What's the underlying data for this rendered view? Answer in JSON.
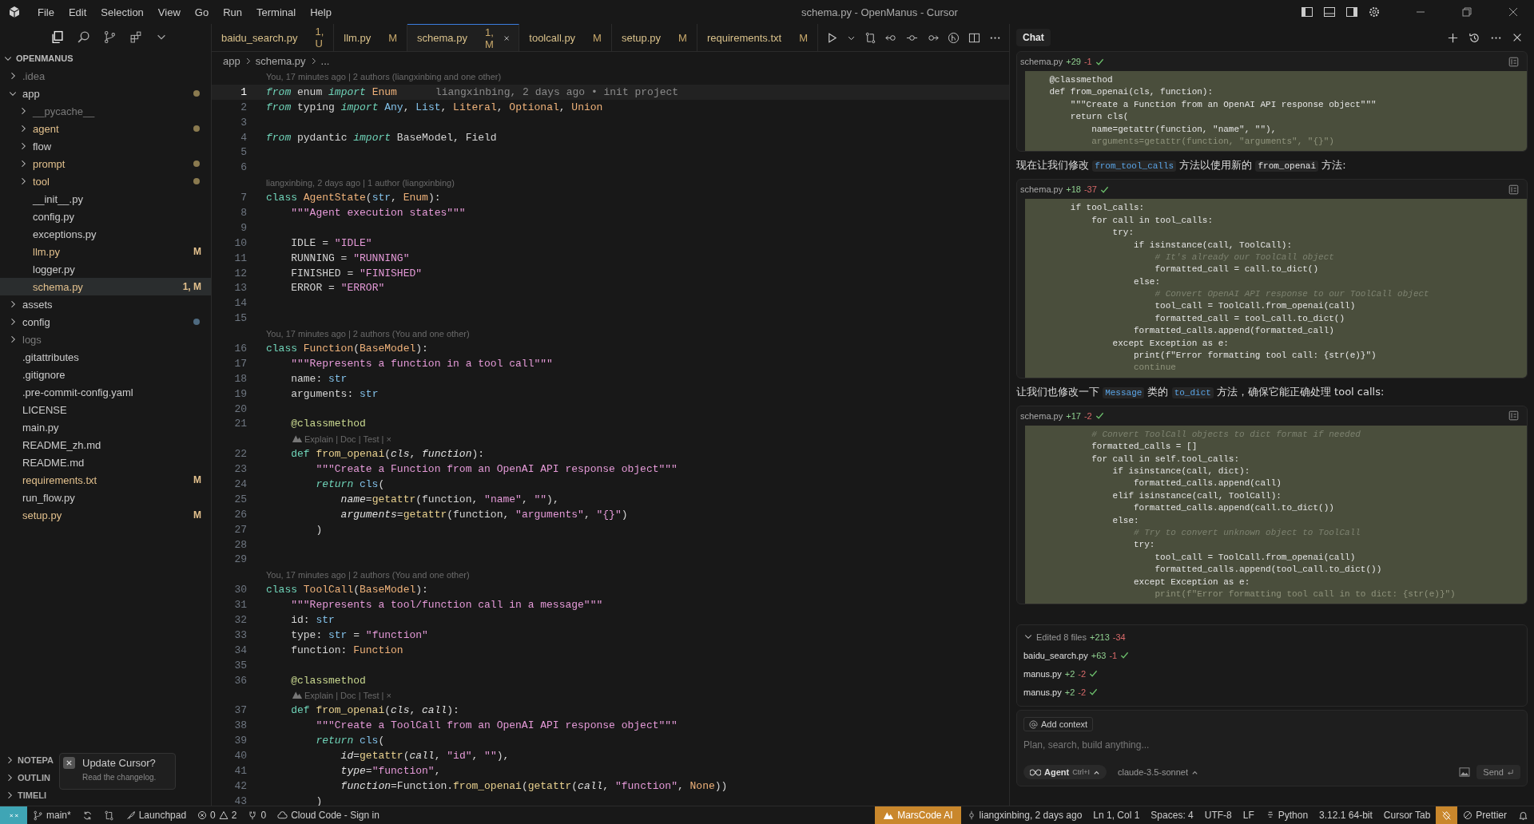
{
  "title_bar": {
    "menu": [
      "File",
      "Edit",
      "Selection",
      "View",
      "Go",
      "Run",
      "Terminal",
      "Help"
    ],
    "title": "schema.py - OpenManus - Cursor"
  },
  "explorer": {
    "title": "OPENMANUS",
    "items": [
      {
        "name": ".idea",
        "kind": "folder",
        "expanded": false,
        "modified": false,
        "ignored": true,
        "selected": false
      },
      {
        "name": "app",
        "kind": "folder",
        "expanded": true,
        "modified": false,
        "ignored": false,
        "color": "#8a7a4f",
        "selected": false,
        "children": [
          {
            "name": "__pycache__",
            "kind": "folder",
            "expanded": false,
            "modified": false,
            "ignored": true,
            "selected": false
          },
          {
            "name": "agent",
            "kind": "folder",
            "expanded": false,
            "modified": true,
            "ignored": false,
            "color": "#8a7a4f",
            "selected": false
          },
          {
            "name": "flow",
            "kind": "folder",
            "expanded": false,
            "modified": false,
            "ignored": false,
            "selected": false
          },
          {
            "name": "prompt",
            "kind": "folder",
            "expanded": false,
            "modified": true,
            "ignored": false,
            "color": "#8a7a4f",
            "selected": false
          },
          {
            "name": "tool",
            "kind": "folder",
            "expanded": false,
            "modified": true,
            "ignored": false,
            "color": "#8a7a4f",
            "selected": false
          },
          {
            "name": "__init__.py",
            "kind": "file",
            "modified": false,
            "ignored": false,
            "selected": false
          },
          {
            "name": "config.py",
            "kind": "file",
            "modified": false,
            "ignored": false,
            "selected": false
          },
          {
            "name": "exceptions.py",
            "kind": "file",
            "modified": false,
            "ignored": false,
            "selected": false
          },
          {
            "name": "llm.py",
            "kind": "file",
            "modified": true,
            "ignored": false,
            "badge": "M",
            "selected": false
          },
          {
            "name": "logger.py",
            "kind": "file",
            "modified": false,
            "ignored": false,
            "selected": false
          },
          {
            "name": "schema.py",
            "kind": "file",
            "modified": true,
            "ignored": false,
            "badge": "1, M",
            "selected": true
          }
        ]
      },
      {
        "name": "assets",
        "kind": "folder",
        "expanded": false,
        "modified": false,
        "ignored": false,
        "selected": false
      },
      {
        "name": "config",
        "kind": "folder",
        "expanded": false,
        "modified": false,
        "ignored": false,
        "color": "#4e6a80",
        "selected": false
      },
      {
        "name": "logs",
        "kind": "folder",
        "expanded": false,
        "modified": false,
        "ignored": true,
        "selected": false
      },
      {
        "name": ".gitattributes",
        "kind": "file",
        "modified": false,
        "ignored": false,
        "selected": false
      },
      {
        "name": ".gitignore",
        "kind": "file",
        "modified": false,
        "ignored": false,
        "selected": false
      },
      {
        "name": ".pre-commit-config.yaml",
        "kind": "file",
        "modified": false,
        "ignored": false,
        "selected": false
      },
      {
        "name": "LICENSE",
        "kind": "file",
        "modified": false,
        "ignored": false,
        "selected": false
      },
      {
        "name": "main.py",
        "kind": "file",
        "modified": false,
        "ignored": false,
        "selected": false
      },
      {
        "name": "README_zh.md",
        "kind": "file",
        "modified": false,
        "ignored": false,
        "selected": false
      },
      {
        "name": "README.md",
        "kind": "file",
        "modified": false,
        "ignored": false,
        "selected": false
      },
      {
        "name": "requirements.txt",
        "kind": "file",
        "modified": true,
        "ignored": false,
        "badge": "M",
        "selected": false
      },
      {
        "name": "run_flow.py",
        "kind": "file",
        "modified": false,
        "ignored": false,
        "selected": false
      },
      {
        "name": "setup.py",
        "kind": "file",
        "modified": true,
        "ignored": false,
        "badge": "M",
        "selected": false
      }
    ],
    "sections": [
      "NOTEPA",
      "OUTLIN",
      "TIMELI"
    ]
  },
  "notification": {
    "title": "Update Cursor?",
    "message": "Read the changelog."
  },
  "tabs": [
    {
      "label": "baidu_search.py",
      "badge": "1, U",
      "selected": false
    },
    {
      "label": "llm.py",
      "badge": "M",
      "selected": false
    },
    {
      "label": "schema.py",
      "badge": "1, M",
      "selected": true
    },
    {
      "label": "toolcall.py",
      "badge": "M",
      "selected": false
    },
    {
      "label": "setup.py",
      "badge": "M",
      "selected": false
    },
    {
      "label": "requirements.txt",
      "badge": "M",
      "selected": false
    }
  ],
  "breadcrumb": [
    "app",
    "schema.py",
    "..."
  ],
  "editor": {
    "rows": [
      {
        "kind": "annotation",
        "text": "You, 17 minutes ago | 2 authors (liangxinbing and one other)"
      },
      {
        "kind": "code",
        "number": "1",
        "active": true,
        "blame": "liangxinbing, 2 days ago • init project",
        "segments": [
          {
            "kind": "kw",
            "text": "from"
          },
          {
            "kind": "plain",
            "text": " enum "
          },
          {
            "kind": "kw",
            "text": "import"
          },
          {
            "kind": "cls",
            "text": " Enum"
          }
        ]
      },
      {
        "kind": "code",
        "number": "2",
        "active": false,
        "segments": [
          {
            "kind": "kw",
            "text": "from"
          },
          {
            "kind": "plain",
            "text": " typing "
          },
          {
            "kind": "kw",
            "text": "import"
          },
          {
            "kind": "type",
            "text": " Any"
          },
          {
            "kind": "plain",
            "text": ", "
          },
          {
            "kind": "type",
            "text": "List"
          },
          {
            "kind": "plain",
            "text": ", "
          },
          {
            "kind": "cls",
            "text": "Literal"
          },
          {
            "kind": "plain",
            "text": ", "
          },
          {
            "kind": "cls",
            "text": "Optional"
          },
          {
            "kind": "plain",
            "text": ", "
          },
          {
            "kind": "cls",
            "text": "Union"
          }
        ]
      },
      {
        "kind": "code",
        "number": "3",
        "active": false
      },
      {
        "kind": "code",
        "number": "4",
        "active": false,
        "segments": [
          {
            "kind": "kw",
            "text": "from"
          },
          {
            "kind": "plain",
            "text": " pydantic "
          },
          {
            "kind": "kw",
            "text": "import"
          },
          {
            "kind": "plain",
            "text": " BaseModel, Field"
          }
        ]
      },
      {
        "kind": "code",
        "number": "5",
        "active": false
      },
      {
        "kind": "code",
        "number": "6",
        "active": false
      },
      {
        "kind": "annotation",
        "text": "liangxinbing, 2 days ago | 1 author (liangxinbing)"
      },
      {
        "kind": "code",
        "number": "7",
        "active": false,
        "segments": [
          {
            "kind": "storage",
            "text": "class"
          },
          {
            "kind": "cls",
            "text": " AgentState"
          },
          {
            "kind": "plain",
            "text": "("
          },
          {
            "kind": "type",
            "text": "str"
          },
          {
            "kind": "plain",
            "text": ", "
          },
          {
            "kind": "cls",
            "text": "Enum"
          },
          {
            "kind": "plain",
            "text": "):"
          }
        ]
      },
      {
        "kind": "code",
        "number": "8",
        "active": false,
        "segments": [
          {
            "kind": "str",
            "text": "    \"\"\"Agent execution states\"\"\""
          }
        ]
      },
      {
        "kind": "code",
        "number": "9",
        "active": false
      },
      {
        "kind": "code",
        "number": "10",
        "active": false,
        "segments": [
          {
            "kind": "plain",
            "text": "    IDLE = "
          },
          {
            "kind": "str",
            "text": "\"IDLE\""
          }
        ]
      },
      {
        "kind": "code",
        "number": "11",
        "active": false,
        "segments": [
          {
            "kind": "plain",
            "text": "    RUNNING = "
          },
          {
            "kind": "str",
            "text": "\"RUNNING\""
          }
        ]
      },
      {
        "kind": "code",
        "number": "12",
        "active": false,
        "segments": [
          {
            "kind": "plain",
            "text": "    FINISHED = "
          },
          {
            "kind": "str",
            "text": "\"FINISHED\""
          }
        ]
      },
      {
        "kind": "code",
        "number": "13",
        "active": false,
        "segments": [
          {
            "kind": "plain",
            "text": "    ERROR = "
          },
          {
            "kind": "str",
            "text": "\"ERROR\""
          }
        ]
      },
      {
        "kind": "code",
        "number": "14",
        "active": false
      },
      {
        "kind": "code",
        "number": "15",
        "active": false
      },
      {
        "kind": "annotation",
        "text": "You, 17 minutes ago | 2 authors (You and one other)"
      },
      {
        "kind": "code",
        "number": "16",
        "active": false,
        "segments": [
          {
            "kind": "storage",
            "text": "class"
          },
          {
            "kind": "cls",
            "text": " Function"
          },
          {
            "kind": "plain",
            "text": "("
          },
          {
            "kind": "cls",
            "text": "BaseModel"
          },
          {
            "kind": "plain",
            "text": "):"
          }
        ]
      },
      {
        "kind": "code",
        "number": "17",
        "active": false,
        "segments": [
          {
            "kind": "str",
            "text": "    \"\"\"Represents a function in a tool call\"\"\""
          }
        ]
      },
      {
        "kind": "code",
        "number": "18",
        "active": false,
        "segments": [
          {
            "kind": "plain",
            "text": "    name: "
          },
          {
            "kind": "type",
            "text": "str"
          }
        ]
      },
      {
        "kind": "code",
        "number": "19",
        "active": false,
        "segments": [
          {
            "kind": "plain",
            "text": "    arguments: "
          },
          {
            "kind": "type",
            "text": "str"
          }
        ]
      },
      {
        "kind": "code",
        "number": "20",
        "active": false
      },
      {
        "kind": "code",
        "number": "21",
        "active": false,
        "segments": [
          {
            "kind": "dec",
            "text": "    @classmethod"
          }
        ]
      },
      {
        "kind": "codelens",
        "text": "Explain | Doc | Test | ×"
      },
      {
        "kind": "code",
        "number": "22",
        "active": false,
        "segments": [
          {
            "kind": "storage",
            "text": "    def"
          },
          {
            "kind": "fn",
            "text": " from_openai"
          },
          {
            "kind": "plain",
            "text": "("
          },
          {
            "kind": "param",
            "text": "cls"
          },
          {
            "kind": "plain",
            "text": ", "
          },
          {
            "kind": "param",
            "text": "function"
          },
          {
            "kind": "plain",
            "text": "):"
          }
        ]
      },
      {
        "kind": "code",
        "number": "23",
        "active": false,
        "segments": [
          {
            "kind": "str",
            "text": "        \"\"\"Create a Function from an OpenAI API response object\"\"\""
          }
        ]
      },
      {
        "kind": "code",
        "number": "24",
        "active": false,
        "segments": [
          {
            "kind": "kw",
            "text": "        return"
          },
          {
            "kind": "type",
            "text": " cls"
          },
          {
            "kind": "plain",
            "text": "("
          }
        ]
      },
      {
        "kind": "code",
        "number": "25",
        "active": false,
        "segments": [
          {
            "kind": "param",
            "text": "            name"
          },
          {
            "kind": "plain",
            "text": "="
          },
          {
            "kind": "fn",
            "text": "getattr"
          },
          {
            "kind": "plain",
            "text": "(function, "
          },
          {
            "kind": "str",
            "text": "\"name\""
          },
          {
            "kind": "plain",
            "text": ", "
          },
          {
            "kind": "str",
            "text": "\"\""
          },
          {
            "kind": "plain",
            "text": "),"
          }
        ]
      },
      {
        "kind": "code",
        "number": "26",
        "active": false,
        "segments": [
          {
            "kind": "param",
            "text": "            arguments"
          },
          {
            "kind": "plain",
            "text": "="
          },
          {
            "kind": "fn",
            "text": "getattr"
          },
          {
            "kind": "plain",
            "text": "(function, "
          },
          {
            "kind": "str",
            "text": "\"arguments\""
          },
          {
            "kind": "plain",
            "text": ", "
          },
          {
            "kind": "str",
            "text": "\"{}\""
          },
          {
            "kind": "plain",
            "text": ")"
          }
        ]
      },
      {
        "kind": "code",
        "number": "27",
        "active": false,
        "segments": [
          {
            "kind": "plain",
            "text": "        )"
          }
        ]
      },
      {
        "kind": "code",
        "number": "28",
        "active": false
      },
      {
        "kind": "code",
        "number": "29",
        "active": false
      },
      {
        "kind": "annotation",
        "text": "You, 17 minutes ago | 2 authors (You and one other)"
      },
      {
        "kind": "code",
        "number": "30",
        "active": false,
        "segments": [
          {
            "kind": "storage",
            "text": "class"
          },
          {
            "kind": "cls",
            "text": " ToolCall"
          },
          {
            "kind": "plain",
            "text": "("
          },
          {
            "kind": "cls",
            "text": "BaseModel"
          },
          {
            "kind": "plain",
            "text": "):"
          }
        ]
      },
      {
        "kind": "code",
        "number": "31",
        "active": false,
        "segments": [
          {
            "kind": "str",
            "text": "    \"\"\"Represents a tool/function call in a message\"\"\""
          }
        ]
      },
      {
        "kind": "code",
        "number": "32",
        "active": false,
        "segments": [
          {
            "kind": "plain",
            "text": "    id: "
          },
          {
            "kind": "type",
            "text": "str"
          }
        ]
      },
      {
        "kind": "code",
        "number": "33",
        "active": false,
        "segments": [
          {
            "kind": "plain",
            "text": "    type: "
          },
          {
            "kind": "type",
            "text": "str"
          },
          {
            "kind": "plain",
            "text": " = "
          },
          {
            "kind": "str",
            "text": "\"function\""
          }
        ]
      },
      {
        "kind": "code",
        "number": "34",
        "active": false,
        "segments": [
          {
            "kind": "plain",
            "text": "    function: "
          },
          {
            "kind": "cls",
            "text": "Function"
          }
        ]
      },
      {
        "kind": "code",
        "number": "35",
        "active": false
      },
      {
        "kind": "code",
        "number": "36",
        "active": false,
        "segments": [
          {
            "kind": "dec",
            "text": "    @classmethod"
          }
        ]
      },
      {
        "kind": "codelens",
        "text": "Explain | Doc | Test | ×"
      },
      {
        "kind": "code",
        "number": "37",
        "active": false,
        "segments": [
          {
            "kind": "storage",
            "text": "    def"
          },
          {
            "kind": "fn",
            "text": " from_openai"
          },
          {
            "kind": "plain",
            "text": "("
          },
          {
            "kind": "param",
            "text": "cls"
          },
          {
            "kind": "plain",
            "text": ", "
          },
          {
            "kind": "param",
            "text": "call"
          },
          {
            "kind": "plain",
            "text": "):"
          }
        ]
      },
      {
        "kind": "code",
        "number": "38",
        "active": false,
        "segments": [
          {
            "kind": "str",
            "text": "        \"\"\"Create a ToolCall from an OpenAI API response object\"\"\""
          }
        ]
      },
      {
        "kind": "code",
        "number": "39",
        "active": false,
        "segments": [
          {
            "kind": "kw",
            "text": "        return"
          },
          {
            "kind": "type",
            "text": " cls"
          },
          {
            "kind": "plain",
            "text": "("
          }
        ]
      },
      {
        "kind": "code",
        "number": "40",
        "active": false,
        "segments": [
          {
            "kind": "param",
            "text": "            id"
          },
          {
            "kind": "plain",
            "text": "="
          },
          {
            "kind": "fn",
            "text": "getattr"
          },
          {
            "kind": "plain",
            "text": "("
          },
          {
            "kind": "param",
            "text": "call"
          },
          {
            "kind": "plain",
            "text": ", "
          },
          {
            "kind": "str",
            "text": "\"id\""
          },
          {
            "kind": "plain",
            "text": ", "
          },
          {
            "kind": "str",
            "text": "\"\""
          },
          {
            "kind": "plain",
            "text": "),"
          }
        ]
      },
      {
        "kind": "code",
        "number": "41",
        "active": false,
        "segments": [
          {
            "kind": "param",
            "text": "            type"
          },
          {
            "kind": "plain",
            "text": "="
          },
          {
            "kind": "str",
            "text": "\"function\""
          },
          {
            "kind": "plain",
            "text": ","
          }
        ]
      },
      {
        "kind": "code",
        "number": "42",
        "active": false,
        "segments": [
          {
            "kind": "param",
            "text": "            function"
          },
          {
            "kind": "plain",
            "text": "=Function."
          },
          {
            "kind": "fn",
            "text": "from_openai"
          },
          {
            "kind": "plain",
            "text": "("
          },
          {
            "kind": "fn",
            "text": "getattr"
          },
          {
            "kind": "plain",
            "text": "("
          },
          {
            "kind": "param",
            "text": "call"
          },
          {
            "kind": "plain",
            "text": ", "
          },
          {
            "kind": "str",
            "text": "\"function\""
          },
          {
            "kind": "plain",
            "text": ", "
          },
          {
            "kind": "cls",
            "text": "None"
          },
          {
            "kind": "plain",
            "text": "))"
          }
        ]
      },
      {
        "kind": "code",
        "number": "43",
        "active": false,
        "segments": [
          {
            "kind": "plain",
            "text": "        )"
          }
        ]
      }
    ]
  },
  "chat": {
    "tab": "Chat",
    "messages": [
      {
        "kind": "code_block",
        "file": "schema.py",
        "added": "+29",
        "removed": "-1",
        "lines": [
          {
            "kind": "code",
            "text": "    @classmethod"
          },
          {
            "kind": "code",
            "text": "    def from_openai(cls, function):"
          },
          {
            "kind": "code",
            "text": "        \"\"\"Create a Function from an OpenAI API response object\"\"\""
          },
          {
            "kind": "code",
            "text": "        return cls("
          },
          {
            "kind": "code",
            "text": "            name=getattr(function, \"name\", \"\"),"
          },
          {
            "kind": "cut",
            "text": "            arguments=getattr(function, \"arguments\", \"{}\")"
          }
        ]
      },
      {
        "kind": "text",
        "segments": [
          {
            "kind": "text",
            "text": "现在让我们修改 "
          },
          {
            "kind": "link_code",
            "text": "from_tool_calls"
          },
          {
            "kind": "text",
            "text": " 方法以使用新的 "
          },
          {
            "kind": "code",
            "text": "from_openai"
          },
          {
            "kind": "text",
            "text": " 方法:"
          }
        ]
      },
      {
        "kind": "code_block",
        "file": "schema.py",
        "added": "+18",
        "removed": "-37",
        "lines": [
          {
            "kind": "code",
            "text": "        if tool_calls:"
          },
          {
            "kind": "code",
            "text": "            for call in tool_calls:"
          },
          {
            "kind": "code",
            "text": "                try:"
          },
          {
            "kind": "code",
            "text": "                    if isinstance(call, ToolCall):"
          },
          {
            "kind": "comment",
            "text": "                        # It's already our ToolCall object"
          },
          {
            "kind": "code",
            "text": "                        formatted_call = call.to_dict()"
          },
          {
            "kind": "code",
            "text": "                    else:"
          },
          {
            "kind": "comment",
            "text": "                        # Convert OpenAI API response to our ToolCall object"
          },
          {
            "kind": "code",
            "text": "                        tool_call = ToolCall.from_openai(call)"
          },
          {
            "kind": "code",
            "text": "                        formatted_call = tool_call.to_dict()"
          },
          {
            "kind": "code",
            "text": "                    formatted_calls.append(formatted_call)"
          },
          {
            "kind": "code",
            "text": "                except Exception as e:"
          },
          {
            "kind": "code",
            "text": "                    print(f\"Error formatting tool call: {str(e)}\")"
          },
          {
            "kind": "cut",
            "text": "                    continue"
          }
        ]
      },
      {
        "kind": "text",
        "segments": [
          {
            "kind": "text",
            "text": "让我们也修改一下 "
          },
          {
            "kind": "link_code",
            "text": "Message"
          },
          {
            "kind": "text",
            "text": " 类的 "
          },
          {
            "kind": "link_code",
            "text": "to_dict"
          },
          {
            "kind": "text",
            "text": " 方法，确保它能正确处理 tool calls:"
          }
        ]
      },
      {
        "kind": "code_block",
        "file": "schema.py",
        "added": "+17",
        "removed": "-2",
        "lines": [
          {
            "kind": "comment",
            "text": "            # Convert ToolCall objects to dict format if needed"
          },
          {
            "kind": "code",
            "text": "            formatted_calls = []"
          },
          {
            "kind": "code",
            "text": "            for call in self.tool_calls:"
          },
          {
            "kind": "code",
            "text": "                if isinstance(call, dict):"
          },
          {
            "kind": "code",
            "text": "                    formatted_calls.append(call)"
          },
          {
            "kind": "code",
            "text": "                elif isinstance(call, ToolCall):"
          },
          {
            "kind": "code",
            "text": "                    formatted_calls.append(call.to_dict())"
          },
          {
            "kind": "code",
            "text": "                else:"
          },
          {
            "kind": "comment",
            "text": "                    # Try to convert unknown object to ToolCall"
          },
          {
            "kind": "code",
            "text": "                    try:"
          },
          {
            "kind": "code",
            "text": "                        tool_call = ToolCall.from_openai(call)"
          },
          {
            "kind": "code",
            "text": "                        formatted_calls.append(tool_call.to_dict())"
          },
          {
            "kind": "code",
            "text": "                    except Exception as e:"
          },
          {
            "kind": "cut",
            "text": "                        print(f\"Error formatting tool call in to dict: {str(e)}\")"
          }
        ]
      }
    ],
    "edited": {
      "label": "Edited 8 files",
      "added": "+213",
      "removed": "-34",
      "expanded": true,
      "files": [
        {
          "name": "baidu_search.py",
          "added": "+63",
          "removed": "-1"
        },
        {
          "name": "manus.py",
          "added": "+2",
          "removed": "-2"
        },
        {
          "name": "manus.py",
          "added": "+2",
          "removed": "-2"
        }
      ]
    },
    "input": {
      "context_button": "Add context",
      "placeholder": "Plan, search, build anything...",
      "mode": "Agent",
      "shortcut": "Ctrl+I",
      "model": "claude-3.5-sonnet",
      "send": "Send"
    }
  },
  "status_bar": {
    "branch": "main*",
    "launchpad": "Launchpad",
    "errors": "0",
    "warnings": "2",
    "ports": "0",
    "cloud": "Cloud Code - Sign in",
    "marscode": "MarsCode AI",
    "blame": "liangxinbing, 2 days ago",
    "position": "Ln 1, Col 1",
    "indentation": "Spaces: 4",
    "encoding": "UTF-8",
    "eol": "LF",
    "language": "Python",
    "interpreter": "3.12.1 64-bit",
    "cursor_tab": "Cursor Tab",
    "formatter": "Prettier"
  }
}
